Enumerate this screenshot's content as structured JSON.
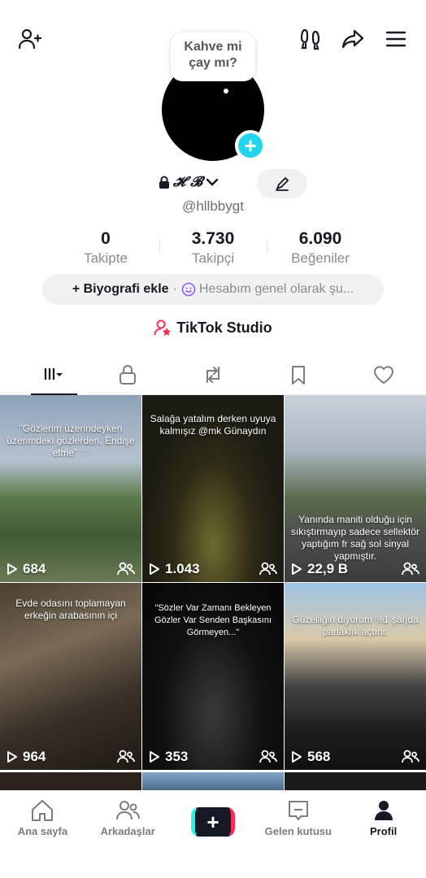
{
  "profile": {
    "bubble_line1": "Kahve mi",
    "bubble_line2": "çay mı?",
    "display_name": "𝓗 𝓑",
    "handle": "@hllbbygt"
  },
  "stats": [
    {
      "value": "0",
      "label": "Takipte"
    },
    {
      "value": "3.730",
      "label": "Takipçi"
    },
    {
      "value": "6.090",
      "label": "Beğeniler"
    }
  ],
  "bio": {
    "add_label": "+ Biyografi ekle",
    "separator": "·",
    "status_text": "Hesabım genel olarak şu..."
  },
  "studio_label": "TikTok Studio",
  "videos": [
    {
      "caption": "\"Gözlerim üzerindeyken üzerimdeki gözlerden, Endişe etme\" ♡",
      "views": "684"
    },
    {
      "caption": "Salağa yatalım derken uyuya kalmışız @mk Günaydın",
      "views": "1.043"
    },
    {
      "caption": "Yanında maniti olduğu için sıkıştırmayıp sadece sellektör yaptığım fr sağ sol sinyal yapmıştır.",
      "views": "22,9 B"
    },
    {
      "caption": "Evde odasını toplamayan erkeğin arabasının içi",
      "views": "964"
    },
    {
      "caption": "\"Sözler Var Zamanı Bekleyen Gözler Var Senden Başkasını Görmeyen...\"",
      "views": "353"
    },
    {
      "caption": "Güzelliğin diyorum %1 şarjda parlaklık açtınr.",
      "views": "568"
    }
  ],
  "nav": [
    {
      "label": "Ana sayfa",
      "icon": "home-icon"
    },
    {
      "label": "Arkadaşlar",
      "icon": "friends-icon"
    },
    {
      "label": "",
      "icon": "create-icon"
    },
    {
      "label": "Gelen kutusu",
      "icon": "inbox-icon"
    },
    {
      "label": "Profil",
      "icon": "profile-icon"
    }
  ],
  "colors": {
    "accent_cyan": "#20d5ec",
    "accent_pink": "#fe2c55",
    "text": "#161823"
  }
}
